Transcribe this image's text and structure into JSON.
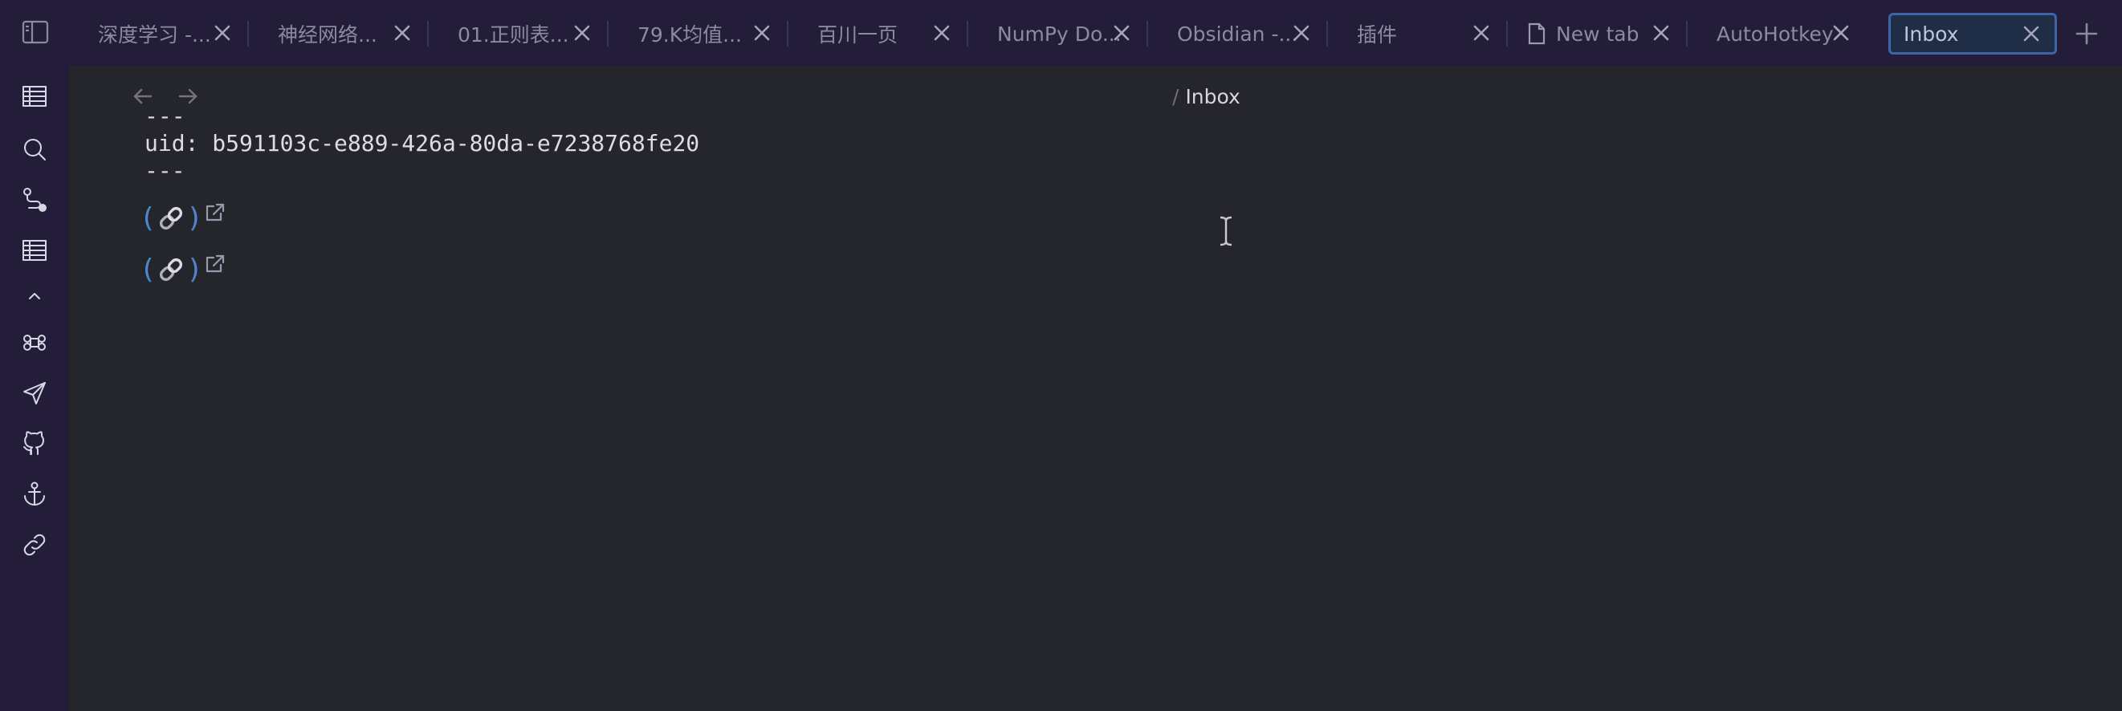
{
  "tabs": [
    {
      "label": "深度学习 -...",
      "active": false
    },
    {
      "label": "神经网络...",
      "active": false
    },
    {
      "label": "01.正则表...",
      "active": false
    },
    {
      "label": "79.K均值...",
      "active": false
    },
    {
      "label": "百川一页",
      "active": false
    },
    {
      "label": "NumPy Do...",
      "active": false
    },
    {
      "label": "Obsidian -...",
      "active": false
    },
    {
      "label": "插件",
      "active": false
    },
    {
      "label": "New tab",
      "active": false,
      "icon": "document-icon"
    },
    {
      "label": "AutoHotkey",
      "active": false
    },
    {
      "label": "Inbox",
      "active": true
    }
  ],
  "ribbon": {
    "icons": [
      "table-icon",
      "search-icon",
      "graph-path-icon",
      "table-icon",
      "chevron-up-icon",
      "command-icon",
      "send-icon",
      "github-icon",
      "anchor-icon",
      "link-icon"
    ]
  },
  "editor": {
    "breadcrumb_sep": "/",
    "breadcrumb": "Inbox",
    "frontmatter_open": "---",
    "uid_line": "uid: b591103c-e889-426a-80da-e7238768fe20",
    "frontmatter_close": "---",
    "link_open": "(",
    "link_close": ")"
  },
  "colors": {
    "ribbon_bg": "#231d3a",
    "editor_bg": "#25262c",
    "active_tab_border": "#3d66a6",
    "link_accent": "#4d87d4"
  }
}
